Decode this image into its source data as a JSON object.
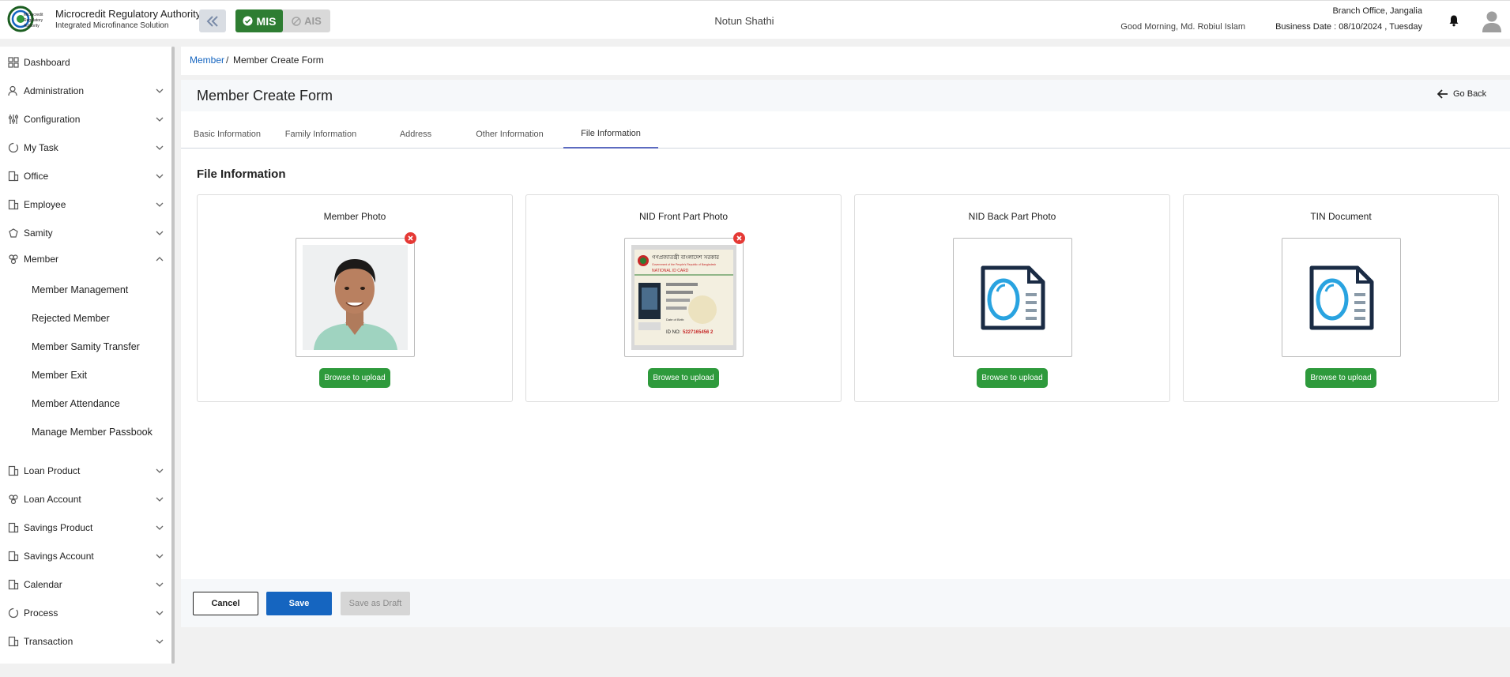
{
  "header": {
    "org_name": "Microcredit Regulatory Authority",
    "org_subtitle": "Integrated Microfinance Solution",
    "logo_text": "Microcredit Regulatory Authority",
    "mode_active": "MIS",
    "mode_inactive": "AIS",
    "organization": "Notun Shathi",
    "greeting": "Good Morning, Md. Robiul Islam",
    "branch": "Branch Office, Jangalia",
    "business_date": "Business Date : 08/10/2024 , Tuesday"
  },
  "sidebar": {
    "items": [
      {
        "label": "Dashboard",
        "icon": "dashboard-icon",
        "expandable": false
      },
      {
        "label": "Administration",
        "icon": "admin-icon",
        "expandable": true
      },
      {
        "label": "Configuration",
        "icon": "config-icon",
        "expandable": true
      },
      {
        "label": "My Task",
        "icon": "task-icon",
        "expandable": true
      },
      {
        "label": "Office",
        "icon": "office-icon",
        "expandable": true
      },
      {
        "label": "Employee",
        "icon": "employee-icon",
        "expandable": true
      },
      {
        "label": "Samity",
        "icon": "samity-icon",
        "expandable": true
      },
      {
        "label": "Member",
        "icon": "member-icon",
        "expandable": true,
        "expanded": true
      },
      {
        "label": "Loan Product",
        "icon": "loan-product-icon",
        "expandable": true
      },
      {
        "label": "Loan Account",
        "icon": "loan-account-icon",
        "expandable": true
      },
      {
        "label": "Savings Product",
        "icon": "savings-product-icon",
        "expandable": true
      },
      {
        "label": "Savings Account",
        "icon": "savings-account-icon",
        "expandable": true
      },
      {
        "label": "Calendar",
        "icon": "calendar-icon",
        "expandable": true
      },
      {
        "label": "Process",
        "icon": "process-icon",
        "expandable": true
      },
      {
        "label": "Transaction",
        "icon": "transaction-icon",
        "expandable": true
      }
    ],
    "member_subitems": [
      "Member Management",
      "Rejected Member",
      "Member Samity Transfer",
      "Member Exit",
      "Member Attendance",
      "Manage Member Passbook"
    ]
  },
  "breadcrumb": {
    "parent": "Member",
    "separator": "/",
    "current": "Member Create Form"
  },
  "form": {
    "title": "Member Create Form",
    "go_back": "Go Back",
    "tabs": [
      "Basic Information",
      "Family Information",
      "Address",
      "Other Information",
      "File Information"
    ],
    "active_tab": "File Information",
    "section_title": "File Information",
    "uploads": [
      {
        "title": "Member Photo",
        "state": "photo-uploaded",
        "browse_label": "Browse to upload",
        "removable": true
      },
      {
        "title": "NID Front Part Photo",
        "state": "nid-uploaded",
        "browse_label": "Browse to upload",
        "removable": true
      },
      {
        "title": "NID Back Part Photo",
        "state": "empty",
        "browse_label": "Browse to upload",
        "removable": false
      },
      {
        "title": "TIN Document",
        "state": "empty",
        "browse_label": "Browse to upload",
        "removable": false
      }
    ],
    "nid_card": {
      "header_bn": "গণপ্রজাতন্ত্রী বাংলাদেশ সরকার",
      "header_en": "Government of the People's Republic of Bangladesh",
      "national_id": "NATIONAL ID CARD",
      "id_label": "ID NO:",
      "id_number": "5227165456 2",
      "dob_label": "Date of Birth:"
    }
  },
  "footer": {
    "cancel": "Cancel",
    "save": "Save",
    "save_draft": "Save as Draft"
  },
  "colors": {
    "primary": "#1565c0",
    "success": "#2e9a3c",
    "mis_green": "#2e7d32",
    "danger": "#e53935",
    "tab_active": "#5c6bc0"
  }
}
